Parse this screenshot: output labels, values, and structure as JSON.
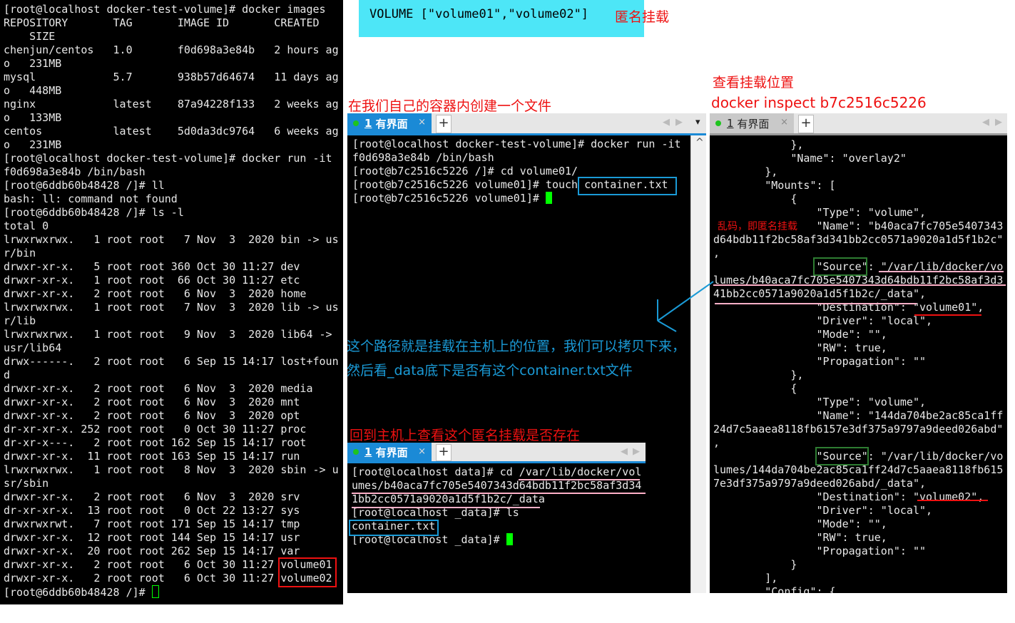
{
  "banner": {
    "code": "VOLUME [\"volume01\",\"volume02\"]",
    "label": "匿名挂载",
    "bg": "#4de6f7"
  },
  "notes": {
    "inspect_title": "查看挂载位置",
    "inspect_cmd": "docker inspect b7c2516c5226",
    "create_file": "在我们自己的容器内创建一个文件",
    "path_note_1": "这个路径就是挂载在主机上的位置，我们可以拷贝下来，",
    "path_note_2": "然后看_data底下是否有这个container.txt文件",
    "back_to_host": "回到主机上查看这个匿名挂载是否存在",
    "garbled": "乱码，即匿名挂载"
  },
  "tabs": {
    "number": "1",
    "label": "有界面",
    "close": "×",
    "add": "+",
    "prev": "◀",
    "next": "▶",
    "dropdown": "▾",
    "scroll_up": "^"
  },
  "colors": {
    "tab_active": "#1b8ad6",
    "highlight_red": "#ee1111",
    "highlight_blue": "#1a9ad6",
    "highlight_green": "#2e7d32",
    "underline_pink": "#ffb0c8",
    "cursor": "#00ff00"
  },
  "left_terminal": [
    "[root@localhost docker-test-volume]# docker images",
    "REPOSITORY       TAG       IMAGE ID       CREATED",
    "    SIZE",
    "chenjun/centos   1.0       f0d698a3e84b   2 hours ag",
    "o   231MB",
    "mysql            5.7       938b57d64674   11 days ag",
    "o   448MB",
    "nginx            latest    87a94228f133   2 weeks ag",
    "o   133MB",
    "centos           latest    5d0da3dc9764   6 weeks ag",
    "o   231MB",
    "[root@localhost docker-test-volume]# docker run -it",
    "f0d698a3e84b /bin/bash",
    "[root@6ddb60b48428 /]# ll",
    "bash: ll: command not found",
    "[root@6ddb60b48428 /]# ls -l",
    "total 0",
    "lrwxrwxrwx.   1 root root   7 Nov  3  2020 bin -> us",
    "r/bin",
    "drwxr-xr-x.   5 root root 360 Oct 30 11:27 dev",
    "drwxr-xr-x.   1 root root  66 Oct 30 11:27 etc",
    "drwxr-xr-x.   2 root root   6 Nov  3  2020 home",
    "lrwxrwxrwx.   1 root root   7 Nov  3  2020 lib -> us",
    "r/lib",
    "lrwxrwxrwx.   1 root root   9 Nov  3  2020 lib64 ->",
    "usr/lib64",
    "drwx------.   2 root root   6 Sep 15 14:17 lost+foun",
    "d",
    "drwxr-xr-x.   2 root root   6 Nov  3  2020 media",
    "drwxr-xr-x.   2 root root   6 Nov  3  2020 mnt",
    "drwxr-xr-x.   2 root root   6 Nov  3  2020 opt",
    "dr-xr-xr-x. 252 root root   0 Oct 30 11:27 proc",
    "dr-xr-x---.   2 root root 162 Sep 15 14:17 root",
    "drwxr-xr-x.  11 root root 163 Sep 15 14:17 run",
    "lrwxrwxrwx.   1 root root   8 Nov  3  2020 sbin -> u",
    "sr/sbin",
    "drwxr-xr-x.   2 root root   6 Nov  3  2020 srv",
    "dr-xr-xr-x.  13 root root   0 Oct 22 13:27 sys",
    "drwxrwxrwt.   7 root root 171 Sep 15 14:17 tmp",
    "drwxr-xr-x.  12 root root 144 Sep 15 14:17 usr",
    "drwxr-xr-x.  20 root root 262 Sep 15 14:17 var",
    "drwxr-xr-x.   2 root root   6 Oct 30 11:27 volume01",
    "drwxr-xr-x.   2 root root   6 Oct 30 11:27 volume02",
    "[root@6ddb60b48428 /]# "
  ],
  "container_terminal": [
    "[root@localhost docker-test-volume]# docker run -it",
    "f0d698a3e84b /bin/bash",
    "[root@b7c2516c5226 /]# cd volume01/",
    "[root@b7c2516c5226 volume01]# touch container.txt",
    "[root@b7c2516c5226 volume01]# "
  ],
  "host_terminal": [
    "[root@localhost data]# cd /var/lib/docker/vol",
    "umes/b40aca7fc705e5407343d64bdb11f2bc58af3d34",
    "1bb2cc0571a9020a1d5f1b2c/_data",
    "[root@localhost _data]# ls",
    "container.txt",
    "[root@localhost _data]# "
  ],
  "inspect_terminal": [
    "            },",
    "            \"Name\": \"overlay2\"",
    "        },",
    "        \"Mounts\": [",
    "            {",
    "                \"Type\": \"volume\",",
    "                \"Name\": \"b40aca7fc705e5407343",
    "d64bdb11f2bc58af3d341bb2cc0571a9020a1d5f1b2c\"",
    ",",
    "                \"Source\": \"/var/lib/docker/vo",
    "lumes/b40aca7fc705e5407343d64bdb11f2bc58af3d3",
    "41bb2cc0571a9020a1d5f1b2c/_data\",",
    "                \"Destination\": \"volume01\",",
    "                \"Driver\": \"local\",",
    "                \"Mode\": \"\",",
    "                \"RW\": true,",
    "                \"Propagation\": \"\"",
    "            },",
    "            {",
    "                \"Type\": \"volume\",",
    "                \"Name\": \"144da704be2ac85ca1ff",
    "24d7c5aaea8118fb6157e3df375a9797a9deed026abd\"",
    ",",
    "                \"Source\": \"/var/lib/docker/vo",
    "lumes/144da704be2ac85ca1ff24d7c5aaea8118fb615",
    "7e3df375a9797a9deed026abd/_data\",",
    "                \"Destination\": \"volume02\",",
    "                \"Driver\": \"local\",",
    "                \"Mode\": \"\",",
    "                \"RW\": true,",
    "                \"Propagation\": \"\"",
    "            }",
    "        ],",
    "        \"Config\": {"
  ]
}
